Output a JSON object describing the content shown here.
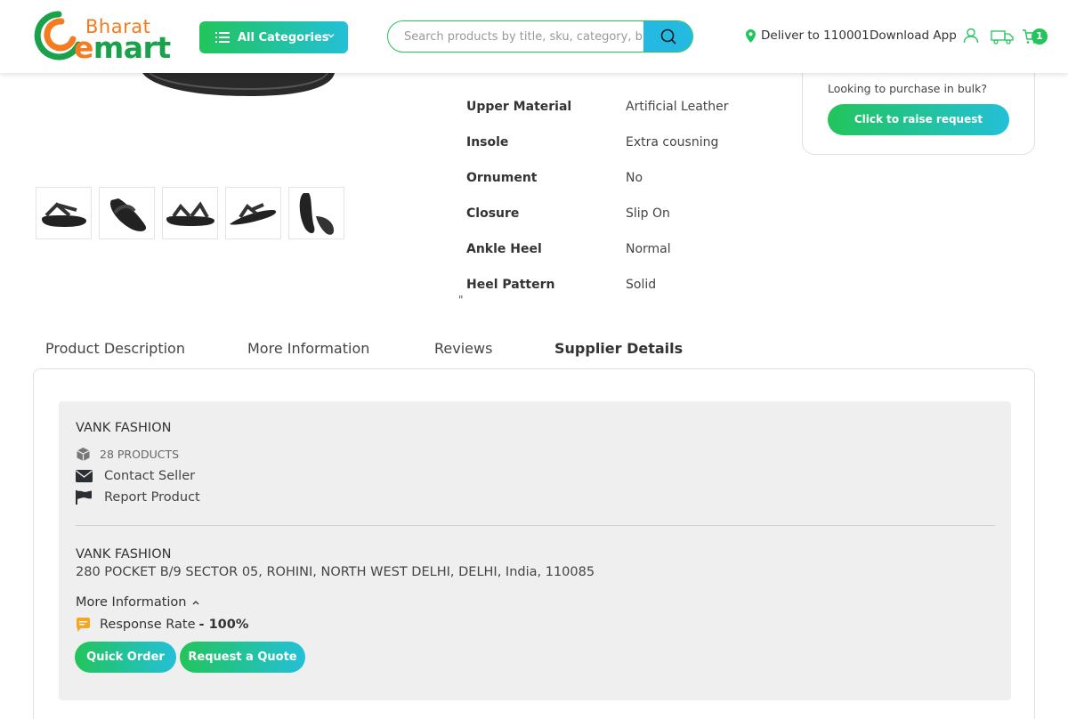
{
  "header": {
    "logo_top": "Bharat",
    "logo_bottom_e": "e",
    "logo_bottom_rest": "mart",
    "categories_label": "All Categories",
    "search_placeholder": "Search products by title, sku, category, b",
    "deliver_label": "Deliver to 110001",
    "download_label": "Download App",
    "cart_count": "1",
    "colors": {
      "green": "#22c45b",
      "blue": "#23b9e0",
      "orange": "#f47b20"
    }
  },
  "product": {
    "specs": [
      {
        "label": "Upper Material",
        "value": "Artificial Leather"
      },
      {
        "label": "Insole",
        "value": "Extra cousning"
      },
      {
        "label": "Ornument",
        "value": "No"
      },
      {
        "label": "Closure",
        "value": "Slip On"
      },
      {
        "label": "Ankle Heel",
        "value": "Normal"
      },
      {
        "label": "Heel Pattern",
        "value": "Solid"
      }
    ],
    "stray_quote": "\"",
    "thumbnails": [
      "sandal-thumb-1",
      "sandal-thumb-2",
      "sandal-thumb-3",
      "sandal-thumb-4",
      "sandal-thumb-5"
    ]
  },
  "bulk": {
    "text": "Looking to purchase in bulk?",
    "button_label": "Click to raise request"
  },
  "tabs": [
    {
      "label": "Product Description",
      "active": false
    },
    {
      "label": "More Information",
      "active": false
    },
    {
      "label": "Reviews",
      "active": false
    },
    {
      "label": "Supplier Details",
      "active": true
    }
  ],
  "supplier": {
    "name": "VANK FASHION",
    "products_count": "28 PRODUCTS",
    "contact_label": "Contact Seller",
    "report_label": "Report Product",
    "address_name": "VANK FASHION",
    "address": "280 POCKET B/9 SECTOR 05, ROHINI, NORTH WEST DELHI, DELHI, India, 110085",
    "more_info_label": "More Information",
    "response_label": "Response Rate",
    "response_value": "- 100%",
    "quick_order_label": "Quick Order",
    "request_quote_label": "Request a Quote"
  }
}
